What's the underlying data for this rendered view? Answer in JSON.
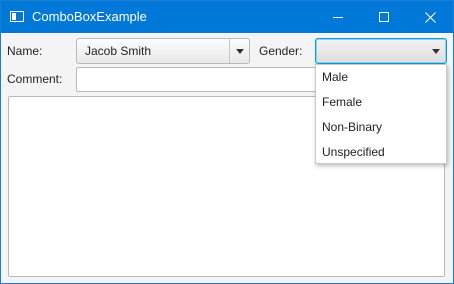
{
  "window": {
    "title": "ComboBoxExample",
    "controls": {
      "minimize": "minimize-icon",
      "maximize": "maximize-icon",
      "close": "close-icon"
    },
    "titlebar_color": "#0078d7"
  },
  "form": {
    "name_label": "Name:",
    "name_value": "Jacob Smith",
    "gender_label": "Gender:",
    "gender_value": "",
    "comment_label": "Comment:",
    "comment_value": "",
    "text_area_value": ""
  },
  "gender_options": [
    "Male",
    "Female",
    "Non-Binary",
    "Unspecified"
  ],
  "focus_color": "#039ed3"
}
